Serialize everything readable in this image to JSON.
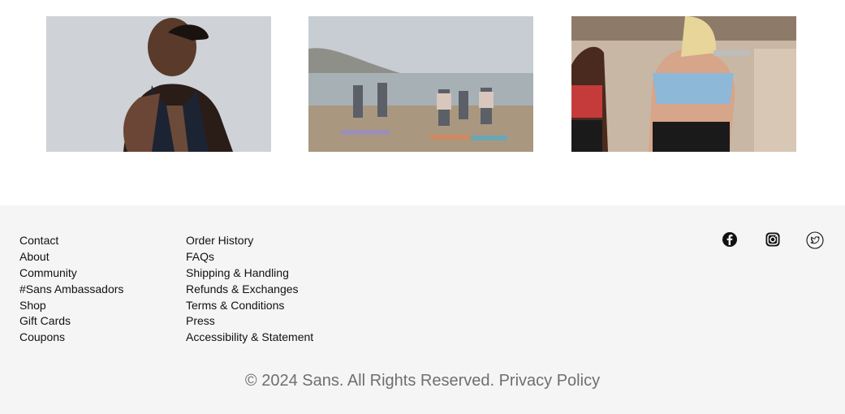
{
  "gallery": {
    "images": [
      {
        "alt": "yoga-meditation"
      },
      {
        "alt": "beach-yoga-group"
      },
      {
        "alt": "gym-dumbbell-class"
      }
    ]
  },
  "footer": {
    "col1": [
      "Contact",
      "About",
      "Community",
      "#Sans Ambassadors",
      "Shop",
      "Gift Cards",
      "Coupons"
    ],
    "col2": [
      "Order History",
      "FAQs",
      "Shipping & Handling",
      "Refunds & Exchanges",
      "Terms & Conditions",
      "Press",
      "Accessibility & Statement"
    ],
    "social": [
      "facebook-icon",
      "instagram-icon",
      "twitter-icon"
    ],
    "copyright": "© 2024 Sans. All Rights Reserved.",
    "privacy": "Privacy Policy"
  },
  "colors": {
    "footer_bg": "#f5f5f5",
    "copyright_text": "#6f6f6f"
  }
}
